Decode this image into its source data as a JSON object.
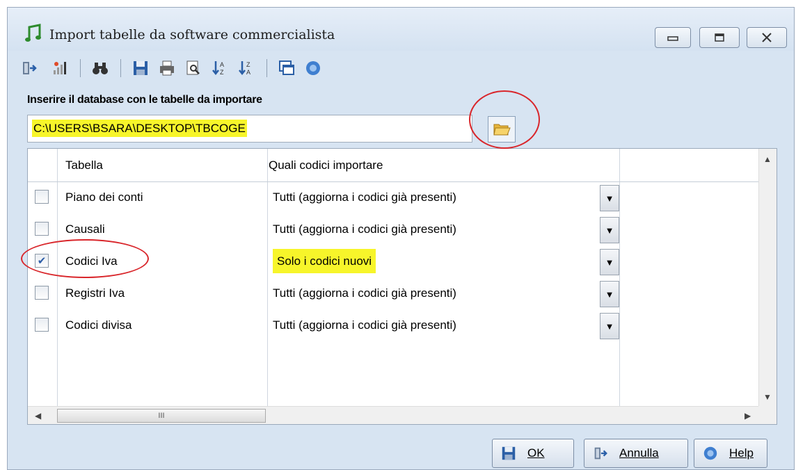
{
  "window": {
    "title": "Import tabelle da software commercialista",
    "title_icon": "music-note-icon",
    "controls": [
      "minimize-icon",
      "maximize-icon",
      "close-icon"
    ]
  },
  "toolbar": {
    "icons": [
      "exit-icon",
      "signal-icon",
      "binoculars-icon",
      "save-icon",
      "print-icon",
      "preview-icon",
      "sort-ascending-icon",
      "sort-descending-icon",
      "windows-icon",
      "help-icon"
    ]
  },
  "database": {
    "label": "Inserire il database con le tabelle da importare",
    "path": "C:\\USERS\\BSARA\\DESKTOP\\TBCOGE",
    "browse_icon": "folder-open-icon"
  },
  "grid": {
    "headers": {
      "table": "Tabella",
      "codes": "Quali codici importare"
    },
    "rows": [
      {
        "checked": false,
        "name": "Piano dei conti",
        "value": "Tutti  (aggiorna i codici già presenti)",
        "highlight": false
      },
      {
        "checked": false,
        "name": "Causali",
        "value": "Tutti  (aggiorna i codici già presenti)",
        "highlight": false
      },
      {
        "checked": true,
        "name": "Codici Iva",
        "value": "Solo i codici nuovi",
        "highlight": true
      },
      {
        "checked": false,
        "name": "Registri Iva",
        "value": "Tutti  (aggiorna i codici già presenti)",
        "highlight": false
      },
      {
        "checked": false,
        "name": "Codici divisa",
        "value": "Tutti  (aggiorna i codici già presenti)",
        "highlight": false
      }
    ],
    "scroll_thumb": "III"
  },
  "buttons": {
    "ok": "OK",
    "cancel": "Annulla",
    "help": "Help"
  },
  "colors": {
    "highlight": "#f7f52a",
    "annotation": "#d9262b",
    "window_bg": "#d7e4f2"
  }
}
